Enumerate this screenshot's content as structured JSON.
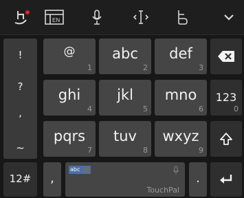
{
  "app": "TouchPal keyboard",
  "toolbar": {
    "items": [
      {
        "name": "touchpal-gesture-icon",
        "has_notification": true
      },
      {
        "name": "layout-en-icon",
        "text": "EN"
      },
      {
        "name": "microphone-icon"
      },
      {
        "name": "cursor-move-icon"
      },
      {
        "name": "emoji-icon"
      },
      {
        "name": "chevron-down-icon"
      }
    ],
    "notification_color": "#e0202a"
  },
  "symbol_column": [
    "!",
    "?",
    ",",
    "~"
  ],
  "rows": [
    [
      {
        "label": "@",
        "num": "1"
      },
      {
        "label": "abc",
        "num": "2"
      },
      {
        "label": "def",
        "num": "3"
      }
    ],
    [
      {
        "label": "ghi",
        "num": "4"
      },
      {
        "label": "jkl",
        "num": "5"
      },
      {
        "label": "mno",
        "num": "6"
      }
    ],
    [
      {
        "label": "pqrs",
        "num": "7"
      },
      {
        "label": "tuv",
        "num": "8"
      },
      {
        "label": "wxyz",
        "num": "9"
      }
    ]
  ],
  "right_column": {
    "backspace": "backspace-icon",
    "mode_label": "123",
    "mode_num": "0",
    "shift": "shift-icon"
  },
  "bottom": {
    "mode_label": "12#",
    "comma": ",",
    "space_brand": "TouchPal",
    "space_tag": "abc",
    "period": ".",
    "enter": "enter-icon"
  },
  "colors": {
    "key": "#454545",
    "dark_key": "#2f2f2f",
    "background": "#171717",
    "text": "#f2f2f2"
  }
}
